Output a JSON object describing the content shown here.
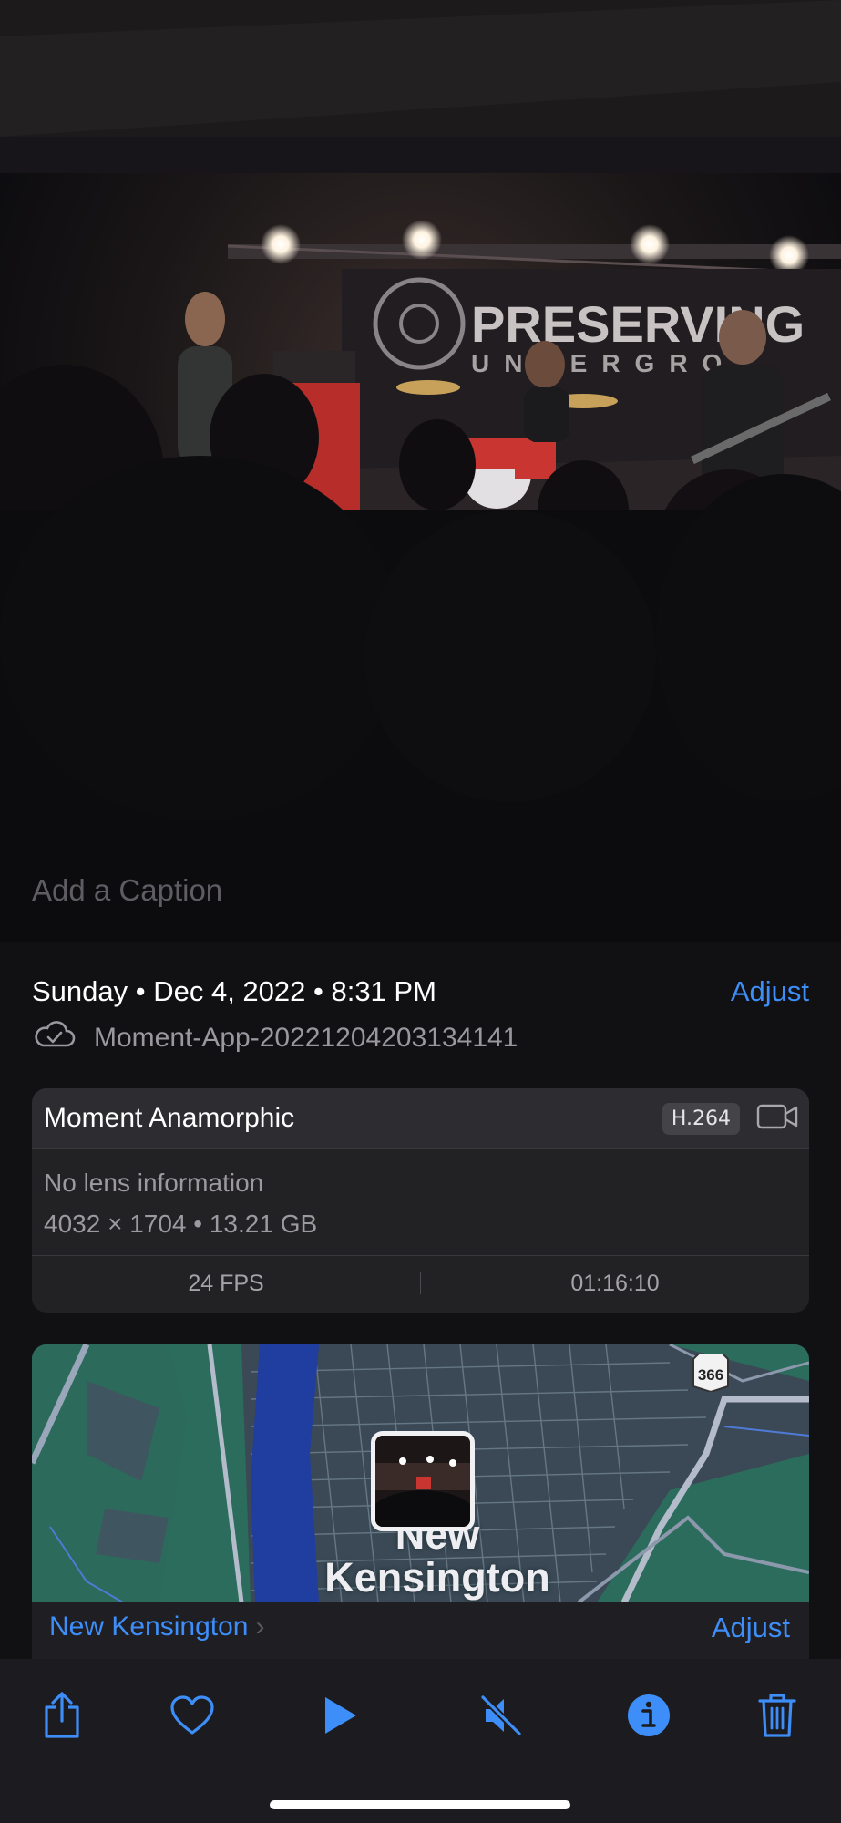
{
  "caption": {
    "placeholder": "Add a Caption"
  },
  "photo": {
    "banner_text_1": "PRESERVING",
    "banner_text_2": "UNDERGRO"
  },
  "info": {
    "date_time": "Sunday • Dec 4, 2022 • 8:31 PM",
    "adjust_label": "Adjust",
    "filename": "Moment-App-20221204203134141",
    "cloud_icon": "icloud-icon"
  },
  "camera_card": {
    "lens_name": "Moment Anamorphic",
    "codec": "H.264",
    "lens_info": "No lens information",
    "dimensions_size": "4032 × 1704  •  13.21 GB",
    "fps": "24 FPS",
    "duration": "01:16:10"
  },
  "map": {
    "city_line1": "New",
    "city_line2": "Kensington",
    "highway_number": "366",
    "place_link": "New Kensington",
    "adjust_label": "Adjust"
  },
  "toolbar": {
    "items": [
      "share-icon",
      "heart-icon",
      "play-icon",
      "mute-icon",
      "info-icon",
      "trash-icon"
    ]
  },
  "colors": {
    "accent": "#3d8ef8",
    "background": "#111013",
    "card": "#222124"
  }
}
